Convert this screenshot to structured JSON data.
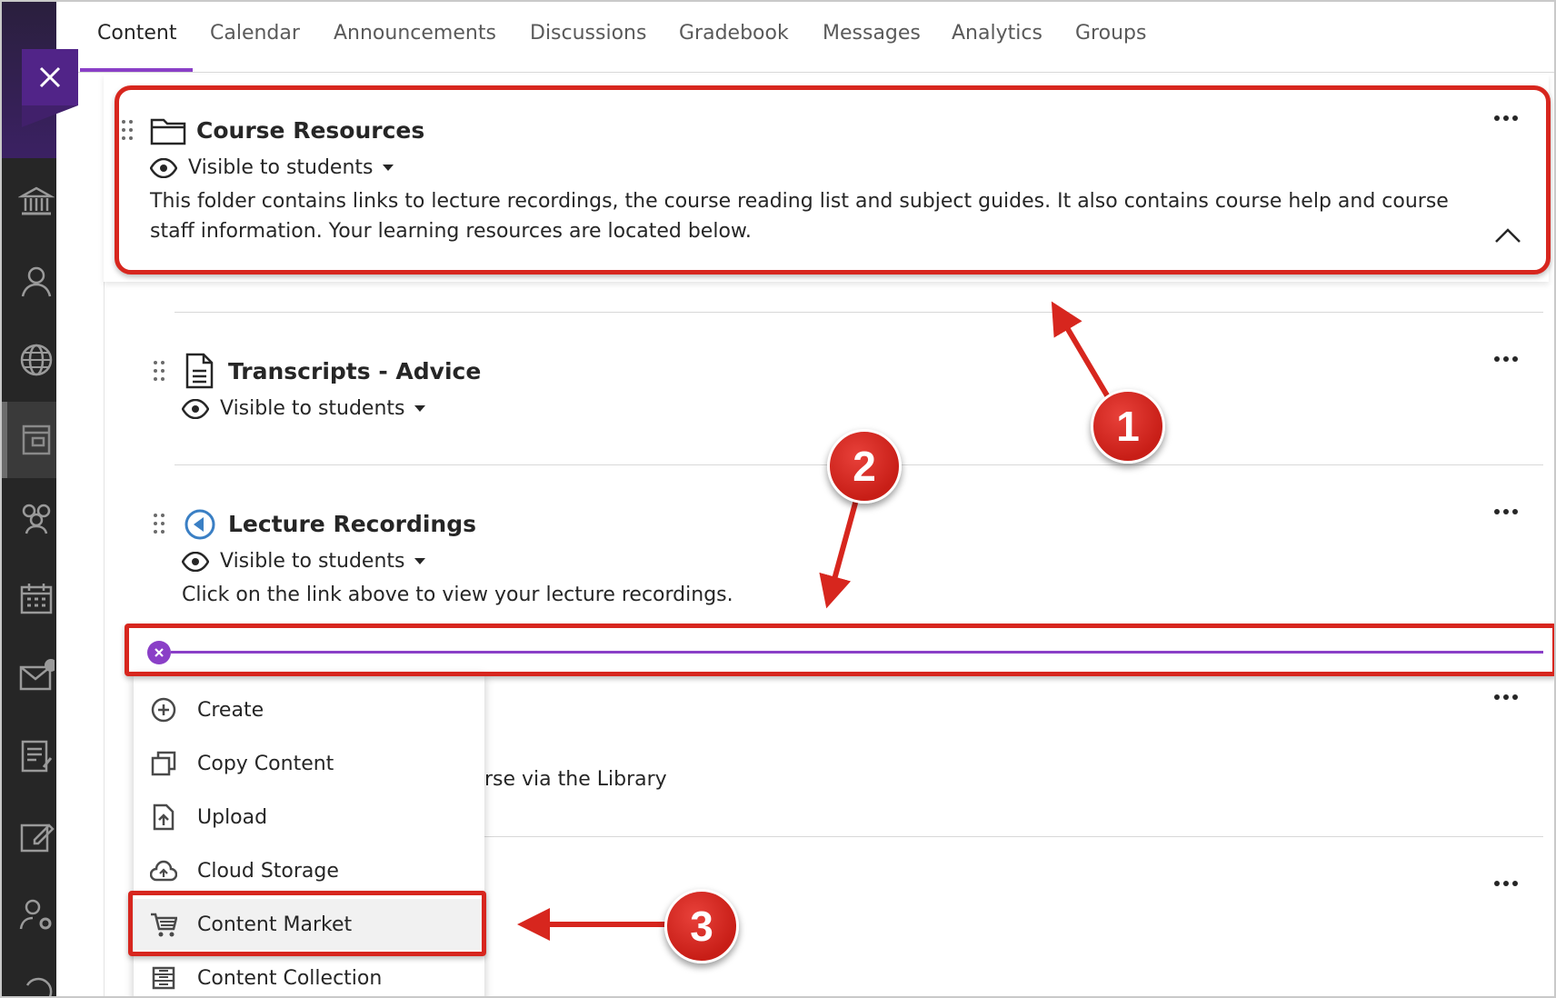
{
  "tabs": [
    {
      "label": "Content",
      "active": true
    },
    {
      "label": "Calendar"
    },
    {
      "label": "Announcements"
    },
    {
      "label": "Discussions"
    },
    {
      "label": "Gradebook"
    },
    {
      "label": "Messages"
    },
    {
      "label": "Analytics"
    },
    {
      "label": "Groups"
    }
  ],
  "items": {
    "course_resources": {
      "title": "Course Resources",
      "visibility": "Visible to students",
      "description": "This folder contains links to lecture recordings, the course reading list and subject guides. It also contains course help and course staff information. Your learning resources are located below."
    },
    "transcripts": {
      "title": "Transcripts - Advice",
      "visibility": "Visible to students"
    },
    "lecture_recordings": {
      "title": "Lecture Recordings",
      "visibility": "Visible to students",
      "description": "Click on the link above to view your lecture recordings."
    },
    "partial_item_text": "rse via the Library"
  },
  "menu": {
    "items": [
      "Create",
      "Copy Content",
      "Upload",
      "Cloud Storage",
      "Content Market",
      "Content Collection"
    ],
    "highlighted": "Content Market"
  },
  "annotations": {
    "badges": [
      "1",
      "2",
      "3"
    ]
  },
  "colors": {
    "accent_purple": "#8a3fc7",
    "brand_purple": "#512488",
    "annotation_red": "#d7261e",
    "rail_dark": "#262626"
  },
  "icons": {
    "rail": [
      "institution-icon",
      "profile-icon",
      "globe-icon",
      "courses-icon",
      "groups-icon",
      "calendar-icon",
      "messages-icon",
      "grades-icon",
      "edit-icon",
      "tools-icon",
      "sign-out-icon"
    ]
  }
}
